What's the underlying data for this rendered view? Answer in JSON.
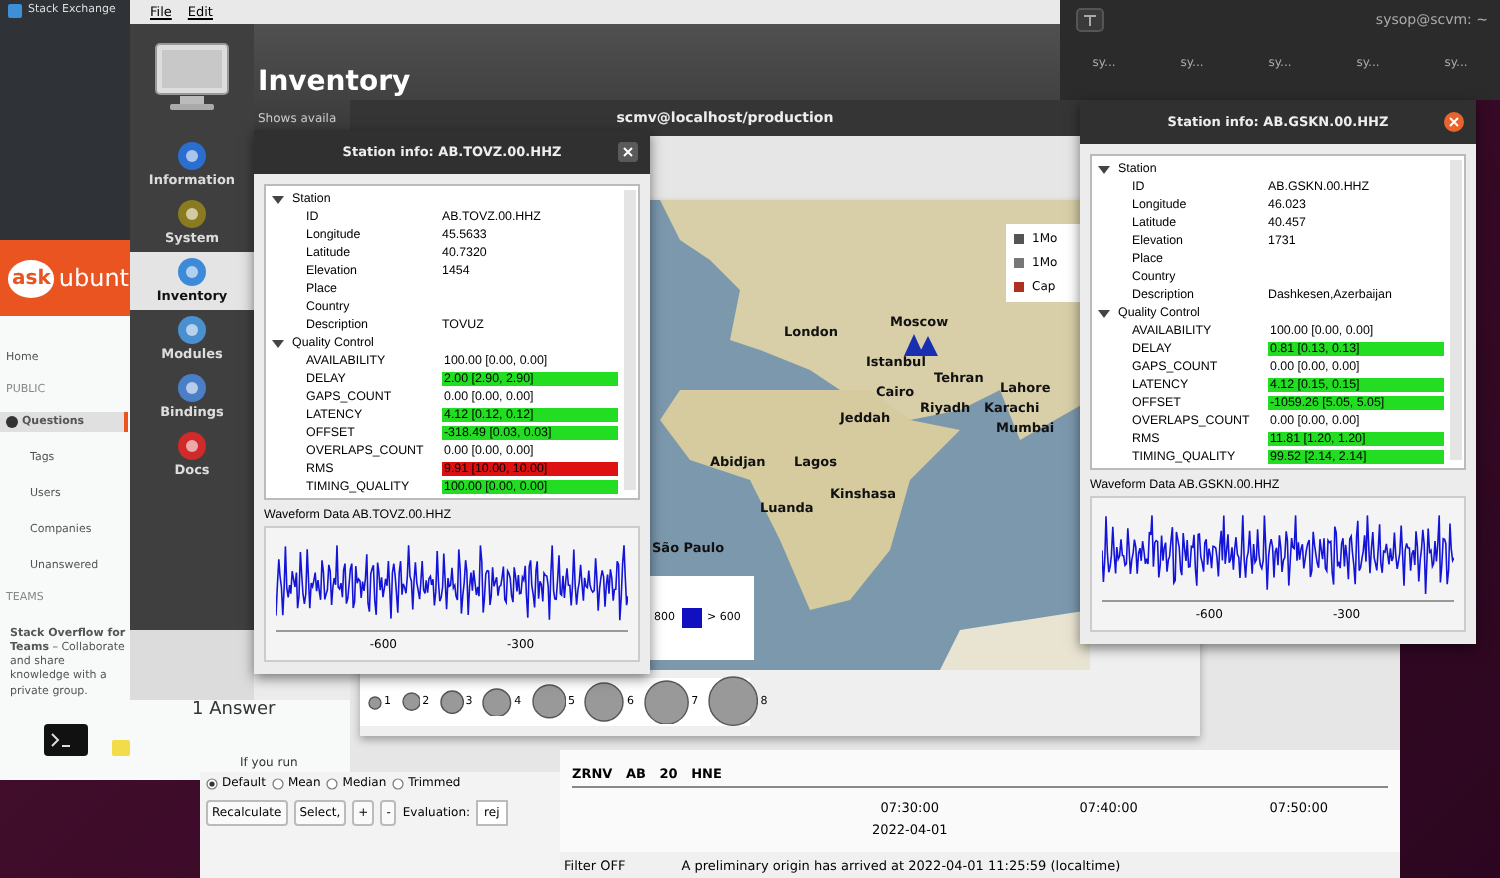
{
  "browser": {
    "site_bar": "Stack Exchange",
    "logo_badge": "ask",
    "logo_text": "ubunt",
    "nav": [
      {
        "label": "Home",
        "kind": "link",
        "selected": false
      },
      {
        "label": "PUBLIC",
        "kind": "heading",
        "selected": false
      },
      {
        "label": "Questions",
        "kind": "link",
        "selected": true
      },
      {
        "label": "Tags",
        "kind": "sublink",
        "selected": false
      },
      {
        "label": "Users",
        "kind": "sublink",
        "selected": false
      },
      {
        "label": "Companies",
        "kind": "sublink",
        "selected": false
      },
      {
        "label": "Unanswered",
        "kind": "sublink",
        "selected": false
      },
      {
        "label": "TEAMS",
        "kind": "heading",
        "selected": false
      }
    ],
    "teams_promo": "**Stack Overflow for Teams** – Collaborate and share knowledge with a private group.",
    "answers_heading": "1 Answer",
    "answer_snippet": "If you run"
  },
  "terminal": {
    "title": "sysop@scvm: ~",
    "tabs": [
      "sy...",
      "sy...",
      "sy...",
      "sy...",
      "sy..."
    ]
  },
  "inventory": {
    "menu": [
      "File",
      "Edit"
    ],
    "title": "Inventory",
    "subtitle": "Shows availa",
    "nav": [
      {
        "label": "Information",
        "selected": false
      },
      {
        "label": "System",
        "selected": false
      },
      {
        "label": "Inventory",
        "selected": true
      },
      {
        "label": "Modules",
        "selected": false
      },
      {
        "label": "Bindings",
        "selected": false
      },
      {
        "label": "Docs",
        "selected": false
      }
    ]
  },
  "scmv": {
    "title": "scmv@localhost/production",
    "cities": [
      "London",
      "Moscow",
      "Istanbul",
      "Tehran",
      "Lahore",
      "Cairo",
      "Riyadh",
      "Karachi",
      "Jeddah",
      "Mumbai",
      "Abidjan",
      "Lagos",
      "Kinshasa",
      "Luanda",
      "São Paulo"
    ],
    "legend": [
      {
        "label": "1Mo",
        "color": "#555555"
      },
      {
        "label": "1Mo",
        "color": "#777777"
      },
      {
        "label": "Cap",
        "color": "#b03020"
      }
    ],
    "depth_legend": [
      "800",
      "> 600"
    ],
    "magnitudes": [
      "1",
      "2",
      "3",
      "4",
      "5",
      "6",
      "7",
      "8"
    ],
    "trace_label": "ZRNV   AB   20   HNE",
    "time_ticks": [
      {
        "time": "07:30:00",
        "date": "2022-04-01"
      },
      {
        "time": "07:40:00"
      },
      {
        "time": "07:50:00"
      }
    ],
    "status_filter": "Filter OFF",
    "status_message": "A preliminary origin has arrived at 2022-04-01 11:25:59 (localtime)"
  },
  "scolv_controls": {
    "radios": [
      {
        "label": "Default",
        "selected": true
      },
      {
        "label": "Mean",
        "selected": false
      },
      {
        "label": "Median",
        "selected": false
      },
      {
        "label": "Trimmed",
        "selected": false
      }
    ],
    "buttons": [
      "Recalculate",
      "Select,",
      "+",
      "-"
    ],
    "evaluation_label": "Evaluation:",
    "evaluation_value": "rej"
  },
  "station_windows": [
    {
      "title": "Station info: AB.TOVZ.00.HHZ",
      "focused": false,
      "station": {
        "label": "Station",
        "expanded": true,
        "fields": [
          {
            "name": "ID",
            "value": "AB.TOVZ.00.HHZ"
          },
          {
            "name": "Longitude",
            "value": "45.5633"
          },
          {
            "name": "Latitude",
            "value": "40.7320"
          },
          {
            "name": "Elevation",
            "value": "1454"
          },
          {
            "name": "Place"
          },
          {
            "name": "Country"
          },
          {
            "name": "Description",
            "value": "TOVUZ"
          }
        ]
      },
      "qc": {
        "label": "Quality Control",
        "expanded": true,
        "rows": [
          {
            "name": "AVAILABILITY",
            "value": "100.00 [0.00, 0.00]"
          },
          {
            "name": "DELAY",
            "value": "2.00 [2.90, 2.90]",
            "color": "#22dd22"
          },
          {
            "name": "GAPS_COUNT",
            "value": "0.00 [0.00, 0.00]",
            "color": "#ffffff"
          },
          {
            "name": "LATENCY",
            "value": "4.12 [0.12, 0.12]",
            "color": "#22dd22"
          },
          {
            "name": "OFFSET",
            "value": "-318.49 [0.03, 0.03]",
            "color": "#22dd22"
          },
          {
            "name": "OVERLAPS_COUNT",
            "value": "0.00 [0.00, 0.00]",
            "color": "#ffffff"
          },
          {
            "name": "RMS",
            "value": "9.91 [10.00, 10.00]",
            "color": "#dd1111"
          },
          {
            "name": "TIMING_QUALITY",
            "value": "100.00 [0.00, 0.00]",
            "color": "#22dd22"
          }
        ]
      },
      "waveform_title": "Waveform Data AB.TOVZ.00.HHZ",
      "ticks": [
        "-600",
        "-300"
      ]
    },
    {
      "title": "Station info: AB.GSKN.00.HHZ",
      "focused": true,
      "station": {
        "label": "Station",
        "expanded": true,
        "fields": [
          {
            "name": "ID",
            "value": "AB.GSKN.00.HHZ"
          },
          {
            "name": "Longitude",
            "value": "46.023"
          },
          {
            "name": "Latitude",
            "value": "40.457"
          },
          {
            "name": "Elevation",
            "value": "1731"
          },
          {
            "name": "Place"
          },
          {
            "name": "Country"
          },
          {
            "name": "Description",
            "value": "Dashkesen,Azerbaijan"
          }
        ]
      },
      "qc": {
        "label": "Quality Control",
        "expanded": true,
        "rows": [
          {
            "name": "AVAILABILITY",
            "value": "100.00 [0.00, 0.00]"
          },
          {
            "name": "DELAY",
            "value": "0.81 [0.13, 0.13]",
            "color": "#22dd22"
          },
          {
            "name": "GAPS_COUNT",
            "value": "0.00 [0.00, 0.00]",
            "color": "#ffffff"
          },
          {
            "name": "LATENCY",
            "value": "4.12 [0.15, 0.15]",
            "color": "#22dd22"
          },
          {
            "name": "OFFSET",
            "value": "-1059.26 [5.05, 5.05]",
            "color": "#22dd22"
          },
          {
            "name": "OVERLAPS_COUNT",
            "value": "0.00 [0.00, 0.00]",
            "color": "#ffffff"
          },
          {
            "name": "RMS",
            "value": "11.81 [1.20, 1.20]",
            "color": "#22dd22"
          },
          {
            "name": "TIMING_QUALITY",
            "value": "99.52 [2.14, 2.14]",
            "color": "#22dd22"
          }
        ]
      },
      "waveform_title": "Waveform Data AB.GSKN.00.HHZ",
      "ticks": [
        "-600",
        "-300"
      ]
    }
  ]
}
